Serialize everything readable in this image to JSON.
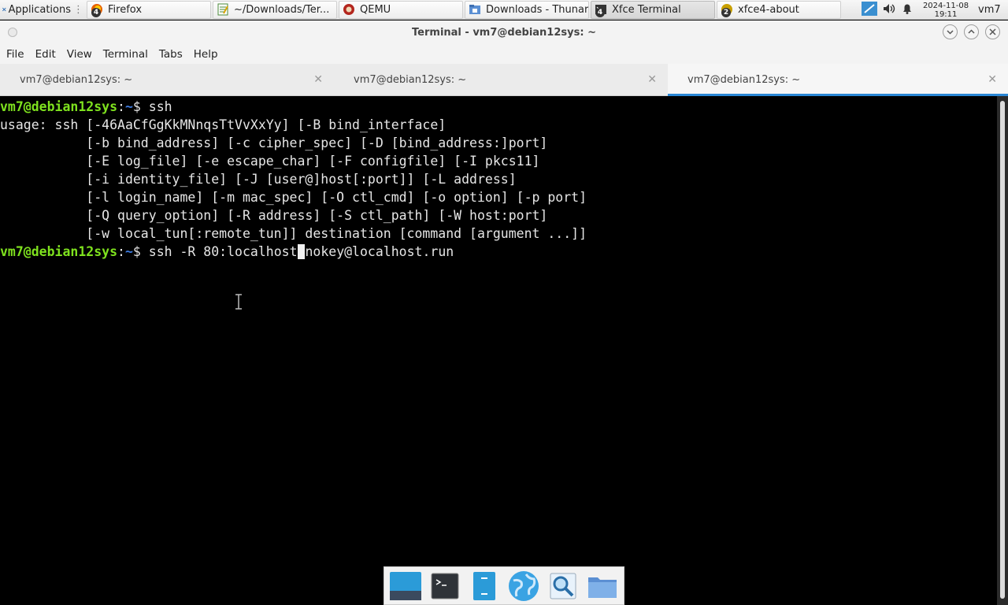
{
  "panel": {
    "applications_label": "Applications",
    "tasks": [
      {
        "label": "Firefox",
        "badge": "4",
        "icon": "firefox-icon",
        "width": 158
      },
      {
        "label": "~/Downloads/Ter...",
        "badge": "",
        "icon": "text-editor-icon",
        "width": 158
      },
      {
        "label": "QEMU",
        "badge": "",
        "icon": "qemu-icon",
        "width": 158
      },
      {
        "label": "Downloads - Thunar",
        "badge": "",
        "icon": "file-manager-icon",
        "width": 158
      },
      {
        "label": "Xfce Terminal",
        "badge": "4",
        "icon": "terminal-icon",
        "width": 158
      },
      {
        "label": "xfce4-about",
        "badge": "2",
        "icon": "about-icon",
        "width": 158
      }
    ],
    "clock_date": "2024-11-08",
    "clock_time": "19:11",
    "user": "vm7"
  },
  "window": {
    "title": "Terminal - vm7@debian12sys: ~"
  },
  "menu": [
    "File",
    "Edit",
    "View",
    "Terminal",
    "Tabs",
    "Help"
  ],
  "tabs": [
    {
      "label": "vm7@debian12sys: ~",
      "active": false
    },
    {
      "label": "vm7@debian12sys: ~",
      "active": false
    },
    {
      "label": "vm7@debian12sys: ~",
      "active": true
    }
  ],
  "terminal": {
    "prompt_user": "vm7@debian12sys",
    "prompt_sep": ":",
    "prompt_path": "~",
    "prompt_dollar": "$ ",
    "cmd1": "ssh",
    "usage_lines": [
      "usage: ssh [-46AaCfGgKkMNnqsTtVvXxYy] [-B bind_interface]",
      "           [-b bind_address] [-c cipher_spec] [-D [bind_address:]port]",
      "           [-E log_file] [-e escape_char] [-F configfile] [-I pkcs11]",
      "           [-i identity_file] [-J [user@]host[:port]] [-L address]",
      "           [-l login_name] [-m mac_spec] [-O ctl_cmd] [-o option] [-p port]",
      "           [-Q query_option] [-R address] [-S ctl_path] [-W host:port]",
      "           [-w local_tun[:remote_tun]] destination [command [argument ...]]"
    ],
    "cmd2_before_cursor": "ssh -R 80:localhost",
    "cmd2_cursor_char": " ",
    "cmd2_after_cursor": "nokey@localhost.run"
  },
  "dock": [
    {
      "name": "show-desktop-icon"
    },
    {
      "name": "terminal-icon"
    },
    {
      "name": "file-manager-icon"
    },
    {
      "name": "web-browser-icon"
    },
    {
      "name": "app-finder-icon"
    },
    {
      "name": "folder-icon"
    }
  ]
}
